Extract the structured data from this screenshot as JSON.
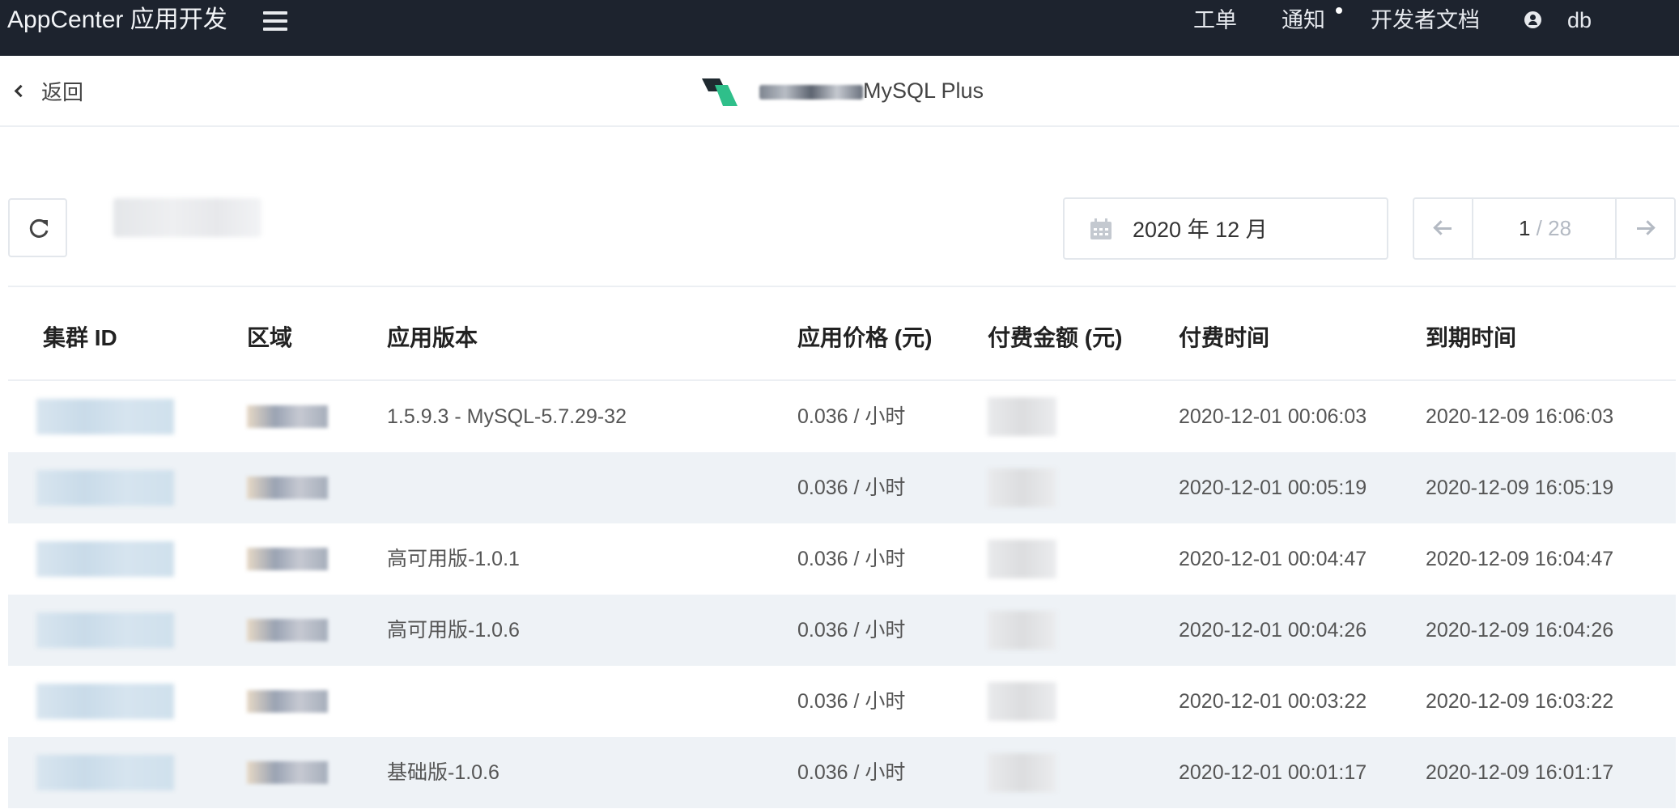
{
  "topbar": {
    "brand": "AppCenter 应用开发",
    "nav": {
      "ticket": "工单",
      "notice": "通知",
      "docs": "开发者文档",
      "user": "db"
    }
  },
  "subheader": {
    "back_label": "返回",
    "app_name": "MySQL Plus"
  },
  "toolbar": {
    "date_value": "2020 年 12 月",
    "pager": {
      "current": "1",
      "separator": "/",
      "total": "28"
    }
  },
  "table": {
    "headers": [
      "集群 ID",
      "区域",
      "应用版本",
      "应用价格 (元)",
      "付费金额 (元)",
      "付费时间",
      "到期时间"
    ],
    "rows": [
      {
        "version": "1.5.9.3 - MySQL-5.7.29-32",
        "price": "0.036 / 小时",
        "paid_time": "2020-12-01 00:06:03",
        "expire_time": "2020-12-09 16:06:03"
      },
      {
        "version": "",
        "price": "0.036 / 小时",
        "paid_time": "2020-12-01 00:05:19",
        "expire_time": "2020-12-09 16:05:19"
      },
      {
        "version": "高可用版-1.0.1",
        "price": "0.036 / 小时",
        "paid_time": "2020-12-01 00:04:47",
        "expire_time": "2020-12-09 16:04:47"
      },
      {
        "version": "高可用版-1.0.6",
        "price": "0.036 / 小时",
        "paid_time": "2020-12-01 00:04:26",
        "expire_time": "2020-12-09 16:04:26"
      },
      {
        "version": "",
        "price": "0.036 / 小时",
        "paid_time": "2020-12-01 00:03:22",
        "expire_time": "2020-12-09 16:03:22"
      },
      {
        "version": "基础版-1.0.6",
        "price": "0.036 / 小时",
        "paid_time": "2020-12-01 00:01:17",
        "expire_time": "2020-12-09 16:01:17"
      }
    ]
  },
  "colors": {
    "topbar_bg": "#1d232e",
    "row_alt_bg": "#eef2f6",
    "logo_dark": "#1f2a30",
    "logo_green": "#2fbf8a"
  }
}
